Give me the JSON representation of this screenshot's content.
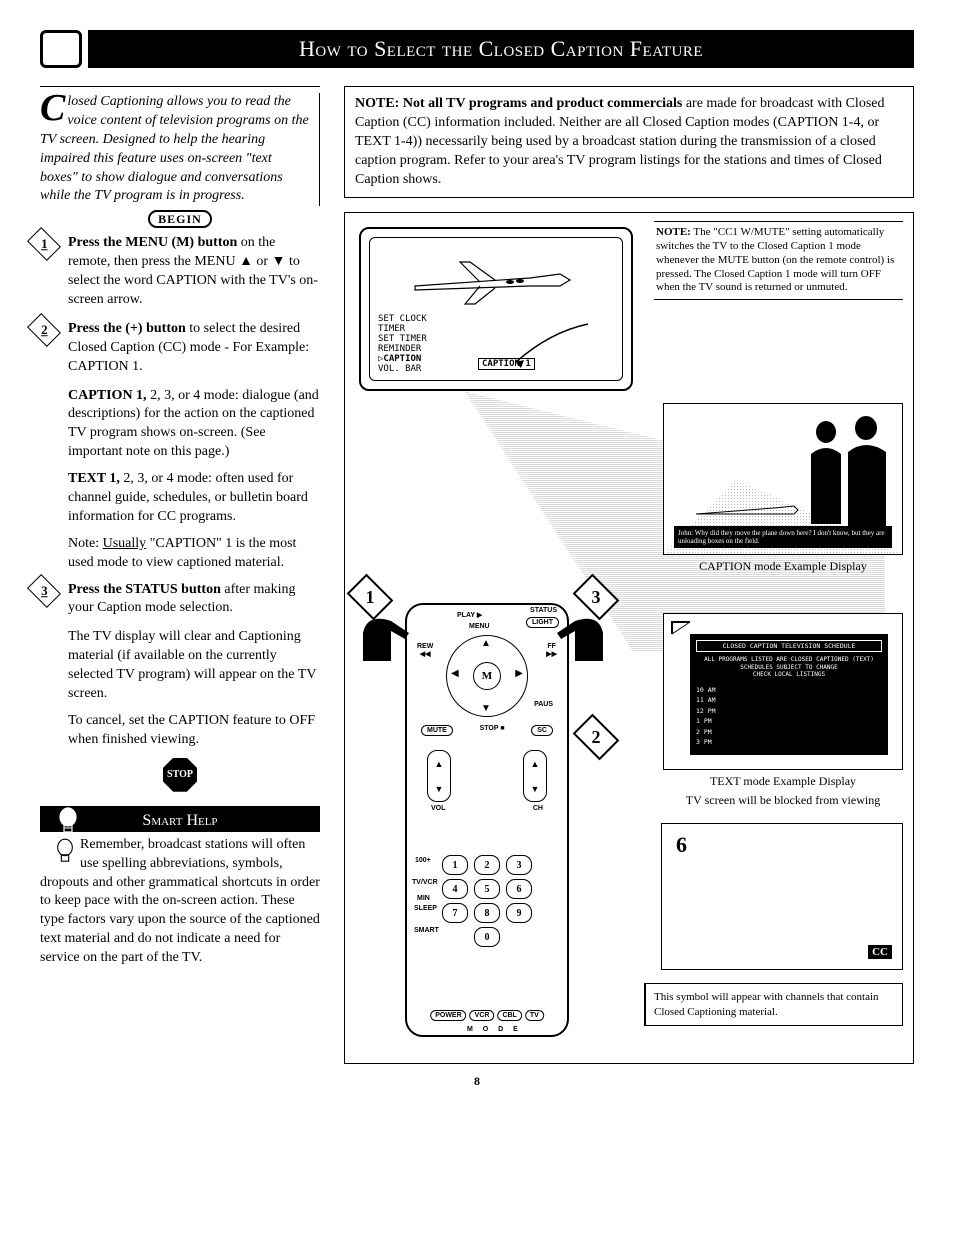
{
  "title": "How to Select the Closed Caption Feature",
  "intro": "losed Captioning allows you to read the voice content of television programs on the TV screen. Designed to help the hearing impaired this feature uses on-screen \"text boxes\" to show dialogue and conversations while the TV program is in progress.",
  "begin": "BEGIN",
  "step1": {
    "lead": "Press the MENU (M) button",
    "rest": " on the remote, then press the MENU ▲ or ▼ to select the word CAPTION with the TV's on-screen arrow."
  },
  "step2": {
    "lead": "Press the (+) button",
    "rest": "  to select the desired Closed Caption (CC) mode - For Example: CAPTION 1."
  },
  "caption_mode": {
    "lead": "CAPTION 1,",
    "rest": " 2, 3, or 4 mode: dialogue (and descriptions) for the action on the captioned TV program shows on-screen. (See important note on this page.)"
  },
  "text_mode": {
    "lead": "TEXT 1,",
    "rest": " 2, 3, or 4 mode: often used for channel guide, schedules, or bulletin board information for CC programs."
  },
  "note_usually_pre": "Note: ",
  "note_usually_u": "Usually",
  "note_usually_post": " \"CAPTION\" 1 is the most used mode to view captioned material.",
  "step3": {
    "lead": "Press the STATUS button",
    "rest": " after making your Caption mode selection."
  },
  "step3_p2": "The TV display will clear and Captioning material (if available on the currently selected TV program) will appear on the TV screen.",
  "step3_p3": "To cancel, set the CAPTION feature to OFF when finished viewing.",
  "stop": "STOP",
  "smart_help": "Smart Help",
  "smart_body": "Remember, broadcast stations will often use spelling abbreviations, symbols, dropouts and other grammatical shortcuts in order to keep pace with the on-screen action. These type factors vary upon the source of the captioned text material and do not indicate a need for service on the part of the TV.",
  "note_box_lead": "NOTE: Not all TV programs and product commercials",
  "note_box_rest": " are made for broadcast with Closed Caption (CC) information included. Neither are all Closed Caption modes (CAPTION 1-4, or TEXT 1-4)) necessarily being used by a broadcast station during the transmission of a closed caption program. Refer to your area's TV program listings for the stations and times of Closed Caption shows.",
  "note2_lead": "NOTE:",
  "note2_body": " The \"CC1 W/MUTE\" setting automatically switches the TV to the Closed Caption 1 mode whenever the MUTE button (on the remote control) is pressed. The Closed Caption 1 mode will turn OFF when the TV sound is returned or unmuted.",
  "menu": [
    "SET CLOCK",
    "TIMER",
    "SET TIMER",
    "REMINDER",
    "CAPTION",
    "VOL. BAR"
  ],
  "caption_pill": "CAPTION 1",
  "caption_example_label": "CAPTION mode Example Display",
  "text_example_label1": "TEXT mode Example Display",
  "text_example_label2": "TV screen will be blocked from viewing",
  "text_panel_hdr": "CLOSED CAPTION TELEVISION SCHEDULE",
  "text_panel_mid": "ALL PROGRAMS LISTED ARE CLOSED CAPTIONED (TEXT)\nSCHEDULES SUBJECT TO CHANGE\nCHECK LOCAL LISTINGS",
  "text_panel_items": [
    "10 AM",
    "11 AM",
    "12 PM",
    "1 PM",
    "2 PM",
    "3 PM"
  ],
  "ch6_num": "6",
  "cc_badge": "CC",
  "symbol_note": "This symbol will appear with channels that contain Closed Captioning material.",
  "remote": {
    "play": "PLAY ▶",
    "status": "STATUS",
    "light": "LIGHT",
    "rew": "REW",
    "ff": "FF",
    "menu": "MENU",
    "m": "M",
    "mute": "MUTE",
    "stop": "STOP ■",
    "sc": "SC",
    "paus": "PAUS",
    "vol": "VOL",
    "ch": "CH",
    "100": "100+",
    "tvvcr": "TV/VCR",
    "sleep": "SLEEP",
    "min": "MIN",
    "smart": "SMART",
    "power": "POWER",
    "vcr": "VCR",
    "cbl": "CBL",
    "tv": "TV",
    "mode": "M  O  D  E"
  },
  "callouts": {
    "c1": "1",
    "c2": "2",
    "c3": "3"
  },
  "page": "8"
}
